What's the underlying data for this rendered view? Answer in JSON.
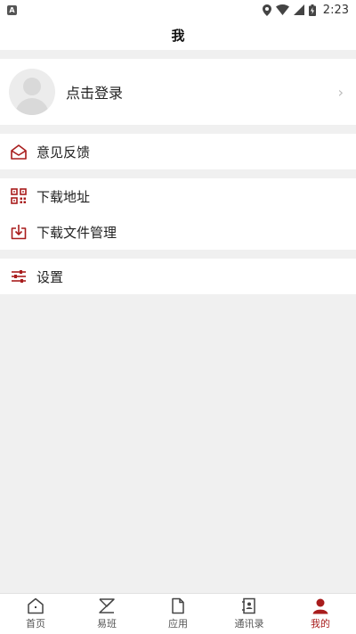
{
  "status_bar": {
    "app_icon_letter": "A",
    "time": "2:23"
  },
  "header": {
    "title": "我"
  },
  "profile": {
    "login_label": "点击登录"
  },
  "menu": {
    "feedback": "意见反馈",
    "download_address": "下载地址",
    "download_manager": "下载文件管理",
    "settings": "设置"
  },
  "tabs": [
    {
      "label": "首页",
      "icon": "home-icon",
      "active": false
    },
    {
      "label": "易班",
      "icon": "yiban-icon",
      "active": false
    },
    {
      "label": "应用",
      "icon": "app-file-icon",
      "active": false
    },
    {
      "label": "通讯录",
      "icon": "contacts-icon",
      "active": false
    },
    {
      "label": "我的",
      "icon": "user-icon",
      "active": true
    }
  ],
  "colors": {
    "accent": "#a81c1c",
    "background": "#f0f0f0"
  }
}
